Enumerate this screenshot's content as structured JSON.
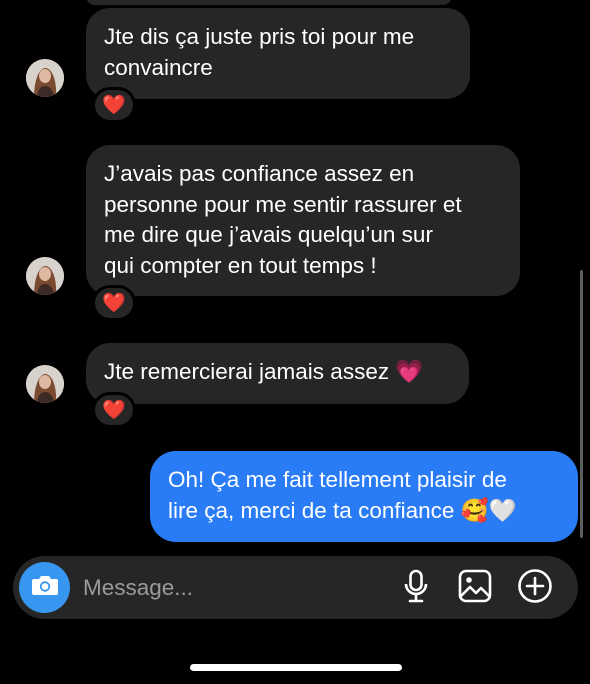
{
  "messages": [
    {
      "text": "Jte dis ça juste pris toi pour me\nconvaincre",
      "direction": "received",
      "reaction": "❤️"
    },
    {
      "text": "J’avais pas confiance assez en\npersonne pour me sentir rassurer et\nme dire que j’avais quelqu’un sur\nqui compter en tout temps !",
      "direction": "received",
      "reaction": "❤️"
    },
    {
      "text": "Jte remercierai jamais assez 💗",
      "direction": "received",
      "reaction": "❤️"
    },
    {
      "text": "Oh! Ça me fait tellement plaisir de\nlire ça, merci de ta confiance 🥰🤍",
      "direction": "sent"
    }
  ],
  "composer": {
    "placeholder": "Message...",
    "icons": [
      "camera-icon",
      "microphone-icon",
      "gallery-icon",
      "add-icon"
    ]
  },
  "colors": {
    "background": "#000000",
    "received_bubble": "#262626",
    "sent_bubble": "#2a7bf6",
    "camera_button": "#3797f0",
    "reaction_heart": "#ff2d55"
  }
}
